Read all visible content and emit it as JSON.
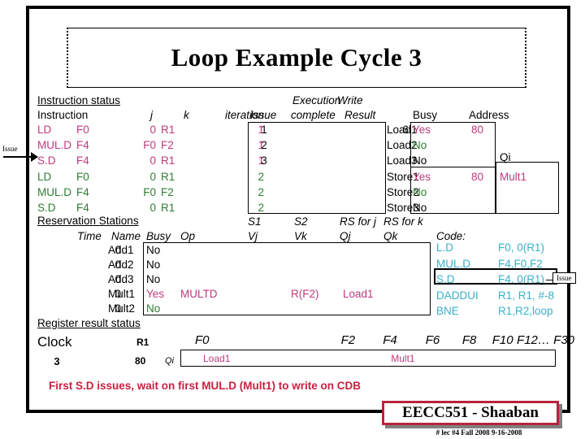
{
  "title": "Loop Example Cycle 3",
  "left_marker": {
    "label": "Issue"
  },
  "instruction_status": {
    "section_title": "Instruction status",
    "headers": {
      "instruction": "Instruction",
      "j": "j",
      "k": "k",
      "iteration": "iteration"
    },
    "rows": [
      {
        "instruction": "LD",
        "dest": "F0",
        "j": "0",
        "k": "R1",
        "iteration": "1",
        "color": "pink"
      },
      {
        "instruction": "MUL.D",
        "dest": "F4",
        "j": "F0",
        "k": "F2",
        "iteration": "1",
        "color": "pink"
      },
      {
        "instruction": "S.D",
        "dest": "F4",
        "j": "0",
        "k": "R1",
        "iteration": "1",
        "color": "pink"
      },
      {
        "instruction": "LD",
        "dest": "F0",
        "j": "0",
        "k": "R1",
        "iteration": "2",
        "color": "green"
      },
      {
        "instruction": "MUL.D",
        "dest": "F4",
        "j": "F0",
        "k": "F2",
        "iteration": "2",
        "color": "green"
      },
      {
        "instruction": "S.D",
        "dest": "F4",
        "j": "0",
        "k": "R1",
        "iteration": "2",
        "color": "green"
      }
    ]
  },
  "execution_status": {
    "group_header_1": "Execution",
    "group_header_2": "Write",
    "headers": {
      "issue": "Issue",
      "complete": "complete",
      "result": "Result"
    },
    "rows": [
      {
        "issue": "1",
        "complete": "",
        "result": ""
      },
      {
        "issue": "2",
        "complete": "",
        "result": ""
      },
      {
        "issue": "3",
        "complete": "",
        "result": ""
      },
      {
        "issue": "",
        "complete": "",
        "result": ""
      },
      {
        "issue": "",
        "complete": "",
        "result": ""
      },
      {
        "issue": "",
        "complete": "",
        "result": ""
      }
    ]
  },
  "load_store_units": {
    "headers": {
      "busy": "Busy",
      "address": "Address",
      "qi": "Qi"
    },
    "rows": [
      {
        "name": "Load1",
        "cycles": "6",
        "busy": "Yes",
        "address": "80",
        "qi": "",
        "color": "pink"
      },
      {
        "name": "Load2",
        "cycles": "",
        "busy": "No",
        "address": "",
        "qi": "",
        "color": "green"
      },
      {
        "name": "Load3",
        "cycles": "",
        "busy": "No",
        "address": "",
        "qi": "",
        "color": "black"
      },
      {
        "name": "Store1",
        "cycles": "",
        "busy": "Yes",
        "address": "80",
        "qi": "Mult1",
        "color": "pink"
      },
      {
        "name": "Store2",
        "cycles": "",
        "busy": "No",
        "address": "",
        "qi": "",
        "color": "green"
      },
      {
        "name": "Store3",
        "cycles": "",
        "busy": "No",
        "address": "",
        "qi": "",
        "color": "black"
      }
    ]
  },
  "reservation_stations": {
    "section_title": "Reservation Stations",
    "headers": {
      "time": "Time",
      "name": "Name",
      "busy": "Busy",
      "op": "Op",
      "s1": "S1",
      "vj": "Vj",
      "s2": "S2",
      "vk": "Vk",
      "rs_for_j": "RS for j",
      "qj": "Qj",
      "rs_for_k": "RS for k",
      "qk": "Qk"
    },
    "rows": [
      {
        "time": "0",
        "name": "Add1",
        "busy": "No",
        "op": "",
        "vj": "",
        "vk": "",
        "qj": "",
        "qk": "",
        "color": "black"
      },
      {
        "time": "0",
        "name": "Add2",
        "busy": "No",
        "op": "",
        "vj": "",
        "vk": "",
        "qj": "",
        "qk": "",
        "color": "black"
      },
      {
        "time": "0",
        "name": "Add3",
        "busy": "No",
        "op": "",
        "vj": "",
        "vk": "",
        "qj": "",
        "qk": "",
        "color": "black"
      },
      {
        "time": "0",
        "name": "Mult1",
        "busy": "Yes",
        "op": "MULTD",
        "vj": "",
        "vk": "R(F2)",
        "qj": "Load1",
        "qk": "",
        "color": "pink"
      },
      {
        "time": "0",
        "name": "Mult2",
        "busy": "No",
        "op": "",
        "vj": "",
        "vk": "",
        "qj": "",
        "qk": "",
        "color": "green"
      }
    ]
  },
  "code": {
    "label": "Code:",
    "highlight_index": 2,
    "callout": "Issue",
    "lines": [
      {
        "op": "L.D",
        "operands": "F0, 0(R1)"
      },
      {
        "op": "MUL.D",
        "operands": "F4,F0,F2"
      },
      {
        "op": "S.D",
        "operands": "F4, 0(R1)"
      },
      {
        "op": "DADDUI",
        "operands": "R1, R1, #-8"
      },
      {
        "op": "BNE",
        "operands": "R1,R2,loop"
      }
    ]
  },
  "register_result_status": {
    "section_title": "Register result status",
    "clock_label": "Clock",
    "clock_value": "3",
    "r1_label": "R1",
    "r1_value": "80",
    "qi_label": "Qi",
    "registers": [
      "F0",
      "F2",
      "F4",
      "F6",
      "F8",
      "F10",
      "F12…",
      "F30"
    ],
    "values": [
      {
        "reg": "F0",
        "value": "Load1"
      },
      {
        "reg": "F4",
        "value": "Mult1"
      }
    ]
  },
  "caption": "First  S.D  issues,  wait on first MUL.D  (Mult1) to write on CDB",
  "footer": {
    "badge": "EECC551 - Shaaban",
    "note": "#  lec #4  Fall 2008   9-16-2008"
  },
  "colors": {
    "pink": "#c0397f",
    "green": "#2e7d32",
    "cyan": "#3aafc9",
    "caption_red": "#cc1f40",
    "badge_border": "#b5243c"
  }
}
